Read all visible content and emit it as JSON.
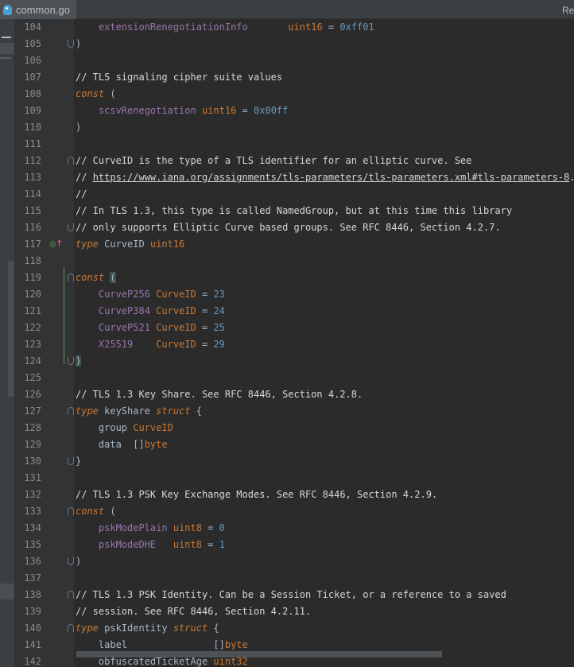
{
  "tab": {
    "filename": "common.go",
    "icon": "go-file-icon"
  },
  "right_panel_label": "Re",
  "lines": [
    {
      "n": "104",
      "fold": "",
      "mark": "",
      "tokens": [
        {
          "t": "    "
        },
        {
          "t": "extensionRenegotiationInfo",
          "c": "t-const"
        },
        {
          "t": "       "
        },
        {
          "t": "uint16",
          "c": "t-type"
        },
        {
          "t": " = ",
          "c": "t-op"
        },
        {
          "t": "0xff01",
          "c": "t-num"
        }
      ]
    },
    {
      "n": "105",
      "fold": "close",
      "mark": "",
      "tokens": [
        {
          "t": ")"
        }
      ]
    },
    {
      "n": "106",
      "fold": "",
      "mark": "",
      "tokens": []
    },
    {
      "n": "107",
      "fold": "",
      "mark": "",
      "tokens": [
        {
          "t": "// TLS signaling cipher suite values",
          "c": "t-com"
        }
      ]
    },
    {
      "n": "108",
      "fold": "",
      "mark": "",
      "tokens": [
        {
          "t": "const",
          "c": "t-kw"
        },
        {
          "t": " ("
        }
      ]
    },
    {
      "n": "109",
      "fold": "",
      "mark": "",
      "tokens": [
        {
          "t": "    "
        },
        {
          "t": "scsvRenegotiation",
          "c": "t-const"
        },
        {
          "t": " "
        },
        {
          "t": "uint16",
          "c": "t-type"
        },
        {
          "t": " = ",
          "c": "t-op"
        },
        {
          "t": "0x00ff",
          "c": "t-num"
        }
      ]
    },
    {
      "n": "110",
      "fold": "",
      "mark": "",
      "tokens": [
        {
          "t": ")"
        }
      ]
    },
    {
      "n": "111",
      "fold": "",
      "mark": "",
      "tokens": []
    },
    {
      "n": "112",
      "fold": "open",
      "mark": "",
      "tokens": [
        {
          "t": "// CurveID is the type of a TLS identifier for an elliptic curve. See",
          "c": "t-com"
        }
      ]
    },
    {
      "n": "113",
      "fold": "",
      "mark": "",
      "tokens": [
        {
          "t": "// ",
          "c": "t-com"
        },
        {
          "t": "https://www.iana.org/assignments/tls-parameters/tls-parameters.xml#tls-parameters-8",
          "c": "t-link"
        },
        {
          "t": ".",
          "c": "t-com"
        }
      ]
    },
    {
      "n": "114",
      "fold": "",
      "mark": "",
      "tokens": [
        {
          "t": "//",
          "c": "t-com"
        }
      ]
    },
    {
      "n": "115",
      "fold": "",
      "mark": "",
      "tokens": [
        {
          "t": "// In TLS 1.3, this type is called NamedGroup, but at this time this library",
          "c": "t-com"
        }
      ]
    },
    {
      "n": "116",
      "fold": "close",
      "mark": "",
      "tokens": [
        {
          "t": "// only supports Elliptic Curve based groups. See RFC 8446, Section 4.2.7.",
          "c": "t-com"
        }
      ]
    },
    {
      "n": "117",
      "fold": "",
      "mark": "impl",
      "tokens": [
        {
          "t": "type",
          "c": "t-kw"
        },
        {
          "t": " CurveID "
        },
        {
          "t": "uint16",
          "c": "t-type"
        }
      ]
    },
    {
      "n": "118",
      "fold": "",
      "mark": "",
      "tokens": []
    },
    {
      "n": "119",
      "fold": "open",
      "mark": "",
      "tokens": [
        {
          "t": "const",
          "c": "t-kw"
        },
        {
          "t": " "
        },
        {
          "t": "(",
          "c": "t-brace"
        }
      ]
    },
    {
      "n": "120",
      "fold": "",
      "mark": "",
      "tokens": [
        {
          "t": "    "
        },
        {
          "t": "CurveP256",
          "c": "t-const"
        },
        {
          "t": " "
        },
        {
          "t": "CurveID",
          "c": "t-type"
        },
        {
          "t": " = ",
          "c": "t-op"
        },
        {
          "t": "23",
          "c": "t-num"
        }
      ]
    },
    {
      "n": "121",
      "fold": "",
      "mark": "",
      "tokens": [
        {
          "t": "    "
        },
        {
          "t": "CurveP384",
          "c": "t-const"
        },
        {
          "t": " "
        },
        {
          "t": "CurveID",
          "c": "t-type"
        },
        {
          "t": " = ",
          "c": "t-op"
        },
        {
          "t": "24",
          "c": "t-num"
        }
      ]
    },
    {
      "n": "122",
      "fold": "",
      "mark": "",
      "tokens": [
        {
          "t": "    "
        },
        {
          "t": "CurveP521",
          "c": "t-const"
        },
        {
          "t": " "
        },
        {
          "t": "CurveID",
          "c": "t-type"
        },
        {
          "t": " = ",
          "c": "t-op"
        },
        {
          "t": "25",
          "c": "t-num"
        }
      ]
    },
    {
      "n": "123",
      "fold": "",
      "mark": "",
      "tokens": [
        {
          "t": "    "
        },
        {
          "t": "X25519",
          "c": "t-const"
        },
        {
          "t": "    "
        },
        {
          "t": "CurveID",
          "c": "t-type"
        },
        {
          "t": " = ",
          "c": "t-op"
        },
        {
          "t": "29",
          "c": "t-num"
        }
      ]
    },
    {
      "n": "124",
      "fold": "close",
      "mark": "",
      "tokens": [
        {
          "t": ")",
          "c": "t-brace"
        }
      ]
    },
    {
      "n": "125",
      "fold": "",
      "mark": "",
      "tokens": []
    },
    {
      "n": "126",
      "fold": "",
      "mark": "",
      "tokens": [
        {
          "t": "// TLS 1.3 Key Share. See RFC 8446, Section 4.2.8.",
          "c": "t-com"
        }
      ]
    },
    {
      "n": "127",
      "fold": "open",
      "mark": "",
      "tokens": [
        {
          "t": "type",
          "c": "t-kw"
        },
        {
          "t": " keyShare "
        },
        {
          "t": "struct",
          "c": "t-kw"
        },
        {
          "t": " {"
        }
      ]
    },
    {
      "n": "128",
      "fold": "",
      "mark": "",
      "tokens": [
        {
          "t": "    group "
        },
        {
          "t": "CurveID",
          "c": "t-type"
        }
      ]
    },
    {
      "n": "129",
      "fold": "",
      "mark": "",
      "tokens": [
        {
          "t": "    data  []"
        },
        {
          "t": "byte",
          "c": "t-type"
        }
      ]
    },
    {
      "n": "130",
      "fold": "close",
      "mark": "",
      "tokens": [
        {
          "t": "}"
        }
      ]
    },
    {
      "n": "131",
      "fold": "",
      "mark": "",
      "tokens": []
    },
    {
      "n": "132",
      "fold": "",
      "mark": "",
      "tokens": [
        {
          "t": "// TLS 1.3 PSK Key Exchange Modes. See RFC 8446, Section 4.2.9.",
          "c": "t-com"
        }
      ]
    },
    {
      "n": "133",
      "fold": "open",
      "mark": "",
      "tokens": [
        {
          "t": "const",
          "c": "t-kw"
        },
        {
          "t": " ("
        }
      ]
    },
    {
      "n": "134",
      "fold": "",
      "mark": "",
      "tokens": [
        {
          "t": "    "
        },
        {
          "t": "pskModePlain",
          "c": "t-const"
        },
        {
          "t": " "
        },
        {
          "t": "uint8",
          "c": "t-type"
        },
        {
          "t": " = ",
          "c": "t-op"
        },
        {
          "t": "0",
          "c": "t-num"
        }
      ]
    },
    {
      "n": "135",
      "fold": "",
      "mark": "",
      "tokens": [
        {
          "t": "    "
        },
        {
          "t": "pskModeDHE",
          "c": "t-const"
        },
        {
          "t": "   "
        },
        {
          "t": "uint8",
          "c": "t-type"
        },
        {
          "t": " = ",
          "c": "t-op"
        },
        {
          "t": "1",
          "c": "t-num"
        }
      ]
    },
    {
      "n": "136",
      "fold": "close",
      "mark": "",
      "tokens": [
        {
          "t": ")"
        }
      ]
    },
    {
      "n": "137",
      "fold": "",
      "mark": "",
      "tokens": []
    },
    {
      "n": "138",
      "fold": "open",
      "mark": "",
      "tokens": [
        {
          "t": "// TLS 1.3 PSK Identity. Can be a Session Ticket, or a reference to a saved",
          "c": "t-com"
        }
      ]
    },
    {
      "n": "139",
      "fold": "",
      "mark": "",
      "tokens": [
        {
          "t": "// session. See RFC 8446, Section 4.2.11.",
          "c": "t-com"
        }
      ]
    },
    {
      "n": "140",
      "fold": "open",
      "mark": "",
      "tokens": [
        {
          "t": "type",
          "c": "t-kw"
        },
        {
          "t": " pskIdentity "
        },
        {
          "t": "struct",
          "c": "t-kw"
        },
        {
          "t": " {"
        }
      ]
    },
    {
      "n": "141",
      "fold": "",
      "mark": "",
      "tokens": [
        {
          "t": "    label               []"
        },
        {
          "t": "byte",
          "c": "t-type"
        }
      ]
    },
    {
      "n": "142",
      "fold": "",
      "mark": "",
      "tokens": [
        {
          "t": "    obfuscatedTicketAge "
        },
        {
          "t": "uint32",
          "c": "t-type"
        }
      ]
    }
  ]
}
